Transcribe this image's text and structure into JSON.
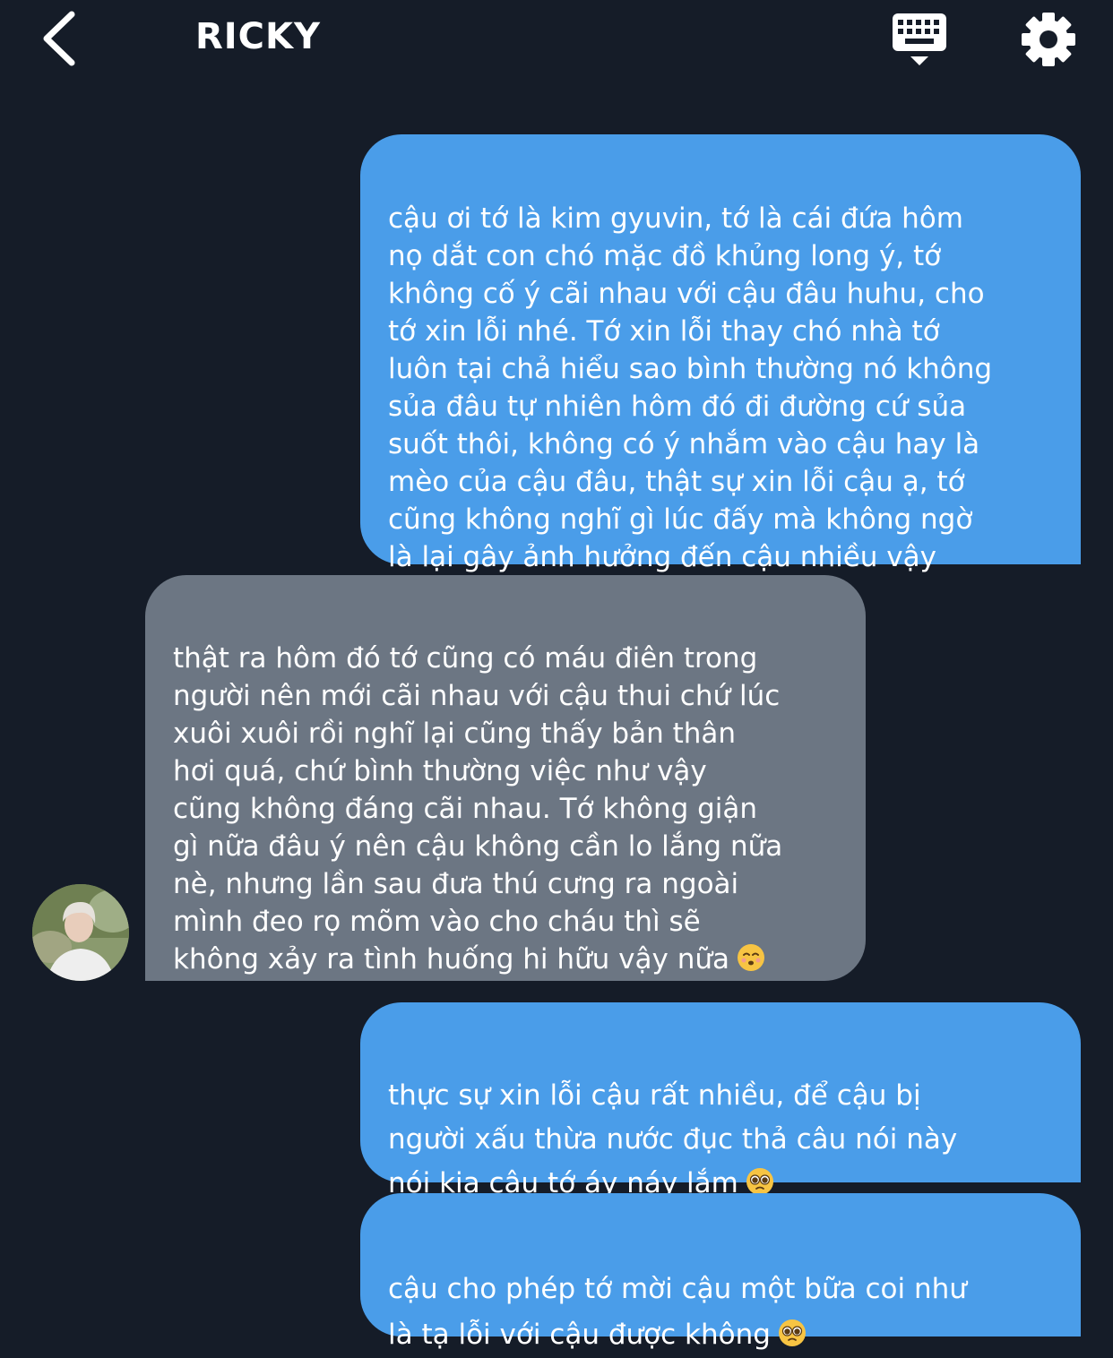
{
  "header": {
    "title": "RICKY",
    "back_icon": "chevron-left-icon",
    "keyboard_icon": "keyboard-icon",
    "settings_icon": "gear-icon"
  },
  "colors": {
    "background": "#151c28",
    "sent_bubble": "#4a9de9",
    "received_bubble": "#6c7683",
    "text": "#ffffff"
  },
  "messages": [
    {
      "sender": "me",
      "text": "cậu ơi tớ là kim gyuvin, tớ là cái đứa hôm\nnọ dắt con chó mặc đồ khủng long ý, tớ\nkhông cố ý cãi nhau với cậu đâu huhu, cho\ntớ xin lỗi nhé. Tớ xin lỗi thay chó nhà tớ\nluôn tại chả hiểu sao bình thường nó không\nsủa đâu tự nhiên hôm đó đi đường cứ sủa\nsuốt thôi, không có ý nhắm vào cậu hay là\nmèo của cậu đâu, thật sự xin lỗi cậu ạ, tớ\ncũng không nghĩ gì lúc đấy mà không ngờ\nlà lại gây ảnh hưởng đến cậu nhiều vậy",
      "emoji": ""
    },
    {
      "sender": "ricky",
      "text": "thật ra hôm đó tớ cũng có máu điên trong\nngười nên mới cãi nhau với cậu thui chứ lúc\nxuôi xuôi rồi nghĩ lại cũng thấy bản thân\nhơi quá, chứ bình thường việc như vậy\ncũng không đáng cãi nhau. Tớ không giận\ngì nữa đâu ý nên cậu không cần lo lắng nữa\nnè, nhưng lần sau đưa thú cưng ra ngoài\nmình đeo rọ mõm vào cho cháu thì  sẽ\nkhông xảy ra tình huống hi hữu vậy nữa",
      "emoji": "kissing-smiling-eyes-emoji"
    },
    {
      "sender": "me",
      "text": "thực sự xin lỗi cậu rất nhiều, để cậu bị\nngười xấu thừa nước đục thả câu nói này\nnói kia cậu tớ áy náy lắm",
      "emoji": "pleading-face-emoji"
    },
    {
      "sender": "me",
      "text": "cậu cho phép tớ mời cậu một bữa coi như\nlà tạ lỗi với cậu được không",
      "emoji": "pleading-face-emoji"
    }
  ],
  "avatar_icon": "user-avatar-photo"
}
